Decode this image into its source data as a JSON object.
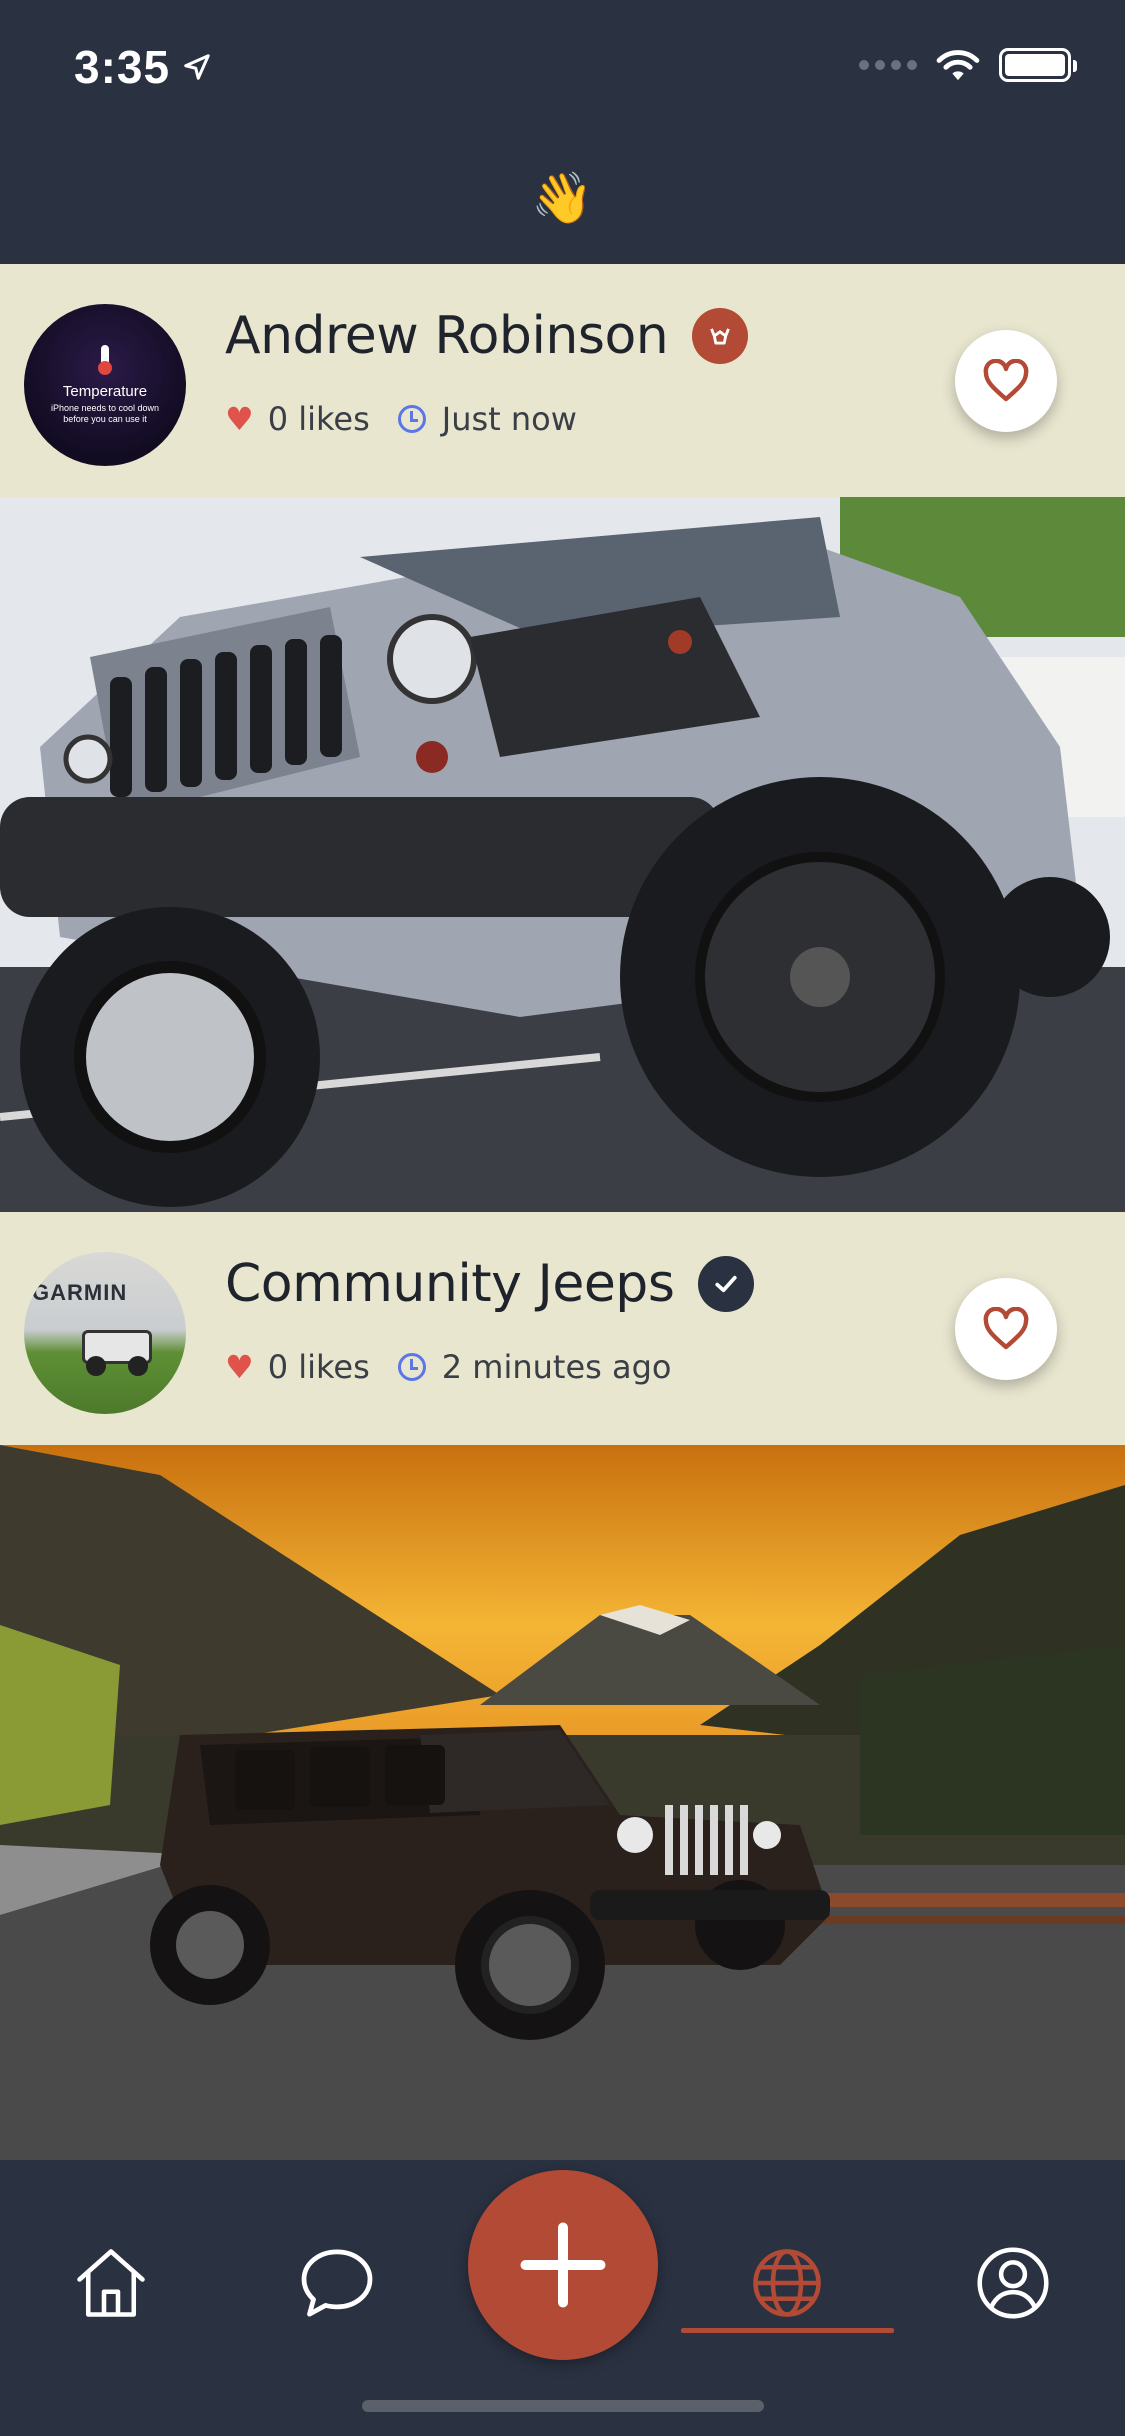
{
  "status_bar": {
    "time": "3:35"
  },
  "header": {
    "emoji": "👋"
  },
  "posts": [
    {
      "user_name": "Andrew Robinson",
      "likes_text": "0 likes",
      "time_text": "Just now",
      "avatar": {
        "title": "Temperature",
        "subtitle": "iPhone needs to cool down before you can use it"
      },
      "badge": "brand-badge-icon",
      "image_alt": "Grey Jeep Wrangler with black wheels"
    },
    {
      "user_name": "Community Jeeps",
      "likes_text": "0 likes",
      "time_text": "2 minutes ago",
      "avatar": {
        "sign_text": "GARMIN"
      },
      "badge": "verified-badge-icon",
      "image_alt": "Brown Jeep Wrangler in front of mountains at sunset"
    }
  ],
  "tab_bar": {
    "tabs": [
      "home",
      "messages",
      "create",
      "explore",
      "profile"
    ],
    "active": "explore",
    "accent_color": "#b24a35"
  },
  "colors": {
    "background": "#2a3141",
    "card": "#e8e6cf",
    "heart": "#e0534a",
    "clock": "#5b76e8"
  }
}
